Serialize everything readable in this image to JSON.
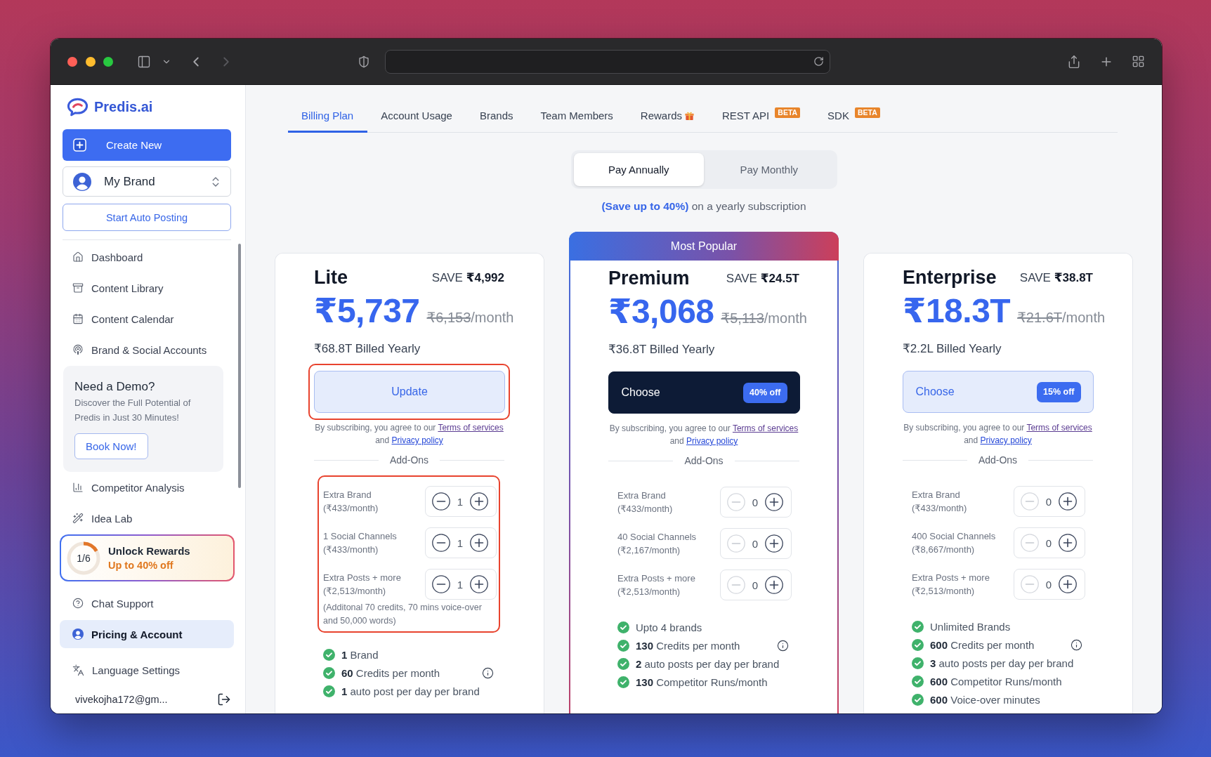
{
  "browser": {
    "back_disabled": false,
    "forward_disabled": true
  },
  "sidebar": {
    "logo": "Predis.ai",
    "create_button": "Create New",
    "brand_select": "My Brand",
    "auto_post_button": "Start Auto Posting",
    "nav": [
      {
        "label": "Dashboard",
        "selected": false
      },
      {
        "label": "Content Library",
        "selected": false
      },
      {
        "label": "Content Calendar",
        "selected": false
      },
      {
        "label": "Brand & Social Accounts",
        "selected": false
      }
    ],
    "demo_card": {
      "title": "Need a Demo?",
      "text": "Discover the Full Potential of Predis in Just 30 Minutes!",
      "button": "Book Now!"
    },
    "nav_more": [
      {
        "label": "Competitor Analysis",
        "selected": false
      },
      {
        "label": "Idea Lab",
        "selected": false
      }
    ],
    "rewards_card": {
      "progress": "1/6",
      "level": 0.167,
      "title": "Unlock Rewards",
      "subtitle": "Up to 40% off"
    },
    "nav_bottom": [
      {
        "label": "Chat Support",
        "selected": false
      },
      {
        "label": "Pricing & Account",
        "selected": true
      }
    ],
    "language_item": {
      "label": "Language Settings",
      "selected": false
    },
    "email": "vivekojha172@gm..."
  },
  "tabs": [
    {
      "label": "Billing Plan",
      "kind": "text",
      "selected": true
    },
    {
      "label": "Account Usage",
      "kind": "text",
      "selected": false
    },
    {
      "label": "Brands",
      "kind": "text",
      "selected": false
    },
    {
      "label": "Team Members",
      "kind": "text",
      "selected": false
    },
    {
      "label": "Rewards",
      "kind": "gift",
      "selected": false
    },
    {
      "label": "REST API",
      "kind": "badge",
      "badge": "BETA",
      "selected": false
    },
    {
      "label": "SDK",
      "kind": "badge",
      "badge": "BETA",
      "selected": false
    }
  ],
  "billing_toggle": [
    {
      "label": "Pay Annually",
      "selected": true
    },
    {
      "label": "Pay Monthly",
      "selected": false
    }
  ],
  "savings_note": "**(Save up to 40%)** on a yearly subscription",
  "plans": [
    {
      "name": "Lite",
      "popular": false,
      "save": "SAVE **₹4,992**",
      "price": "₹5,737",
      "old_price": "₹6,153",
      "period": "/month",
      "billed": "₹68.8T Billed Yearly",
      "cta": {
        "label": "Update",
        "kind": "soft",
        "highlighted": true
      },
      "terms": {
        "before": "By subscribing, you agree to our",
        "joiner": "and",
        "links": [
          {
            "label": "Terms of services",
            "visited": true
          },
          {
            "label": "Privacy policy",
            "visited": false
          }
        ]
      },
      "addons_title": "Add-Ons",
      "addons_highlighted": true,
      "addons": [
        {
          "name": "Extra Brand",
          "price": "(₹433/month)",
          "value": "1",
          "decrease_disabled": false
        },
        {
          "name": "1 Social Channels",
          "price": "(₹433/month)",
          "value": "1",
          "decrease_disabled": false
        },
        {
          "name": "Extra Posts + more",
          "price": "(₹2,513/month)",
          "value": "1",
          "decrease_disabled": false
        }
      ],
      "addons_note": "(Additonal 70 credits, 70 mins voice-over and 50,000 words)",
      "features": [
        {
          "text": "**1** Brand",
          "info": false
        },
        {
          "text": "**60** Credits per month",
          "info": true
        },
        {
          "text": "**1** auto post per day per brand",
          "info": false
        }
      ]
    },
    {
      "name": "Premium",
      "popular": true,
      "ribbon": "Most Popular",
      "save": "SAVE **₹24.5T**",
      "price": "₹3,068",
      "old_price": "₹5,113",
      "period": "/month",
      "billed": "₹36.8T Billed Yearly",
      "cta": {
        "label": "Choose",
        "kind": "dark",
        "badge": "40% off",
        "highlighted": false
      },
      "terms": {
        "before": "By subscribing, you agree to our",
        "joiner": "and",
        "links": [
          {
            "label": "Terms of services",
            "visited": true
          },
          {
            "label": "Privacy policy",
            "visited": false
          }
        ]
      },
      "addons_title": "Add-Ons",
      "addons_highlighted": false,
      "addons": [
        {
          "name": "Extra Brand",
          "price": "(₹433/month)",
          "value": "0",
          "decrease_disabled": true
        },
        {
          "name": "40 Social Channels",
          "price": "(₹2,167/month)",
          "value": "0",
          "decrease_disabled": true
        },
        {
          "name": "Extra Posts + more",
          "price": "(₹2,513/month)",
          "value": "0",
          "decrease_disabled": true
        }
      ],
      "features": [
        {
          "text": "Upto 4 brands",
          "info": false
        },
        {
          "text": "**130** Credits per month",
          "info": true
        },
        {
          "text": "**2** auto posts per day per brand",
          "info": false
        },
        {
          "text": "**130** Competitor Runs/month",
          "info": false
        }
      ]
    },
    {
      "name": "Enterprise",
      "popular": false,
      "save": "SAVE **₹38.8T**",
      "price": "₹18.3T",
      "old_price": "₹21.6T",
      "period": "/month",
      "billed": "₹2.2L Billed Yearly",
      "cta": {
        "label": "Choose",
        "kind": "soft",
        "badge": "15% off",
        "highlighted": false
      },
      "terms": {
        "before": "By subscribing, you agree to our",
        "joiner": "and",
        "links": [
          {
            "label": "Terms of services",
            "visited": true
          },
          {
            "label": "Privacy policy",
            "visited": false
          }
        ]
      },
      "addons_title": "Add-Ons",
      "addons_highlighted": false,
      "addons": [
        {
          "name": "Extra Brand",
          "price": "(₹433/month)",
          "value": "0",
          "decrease_disabled": true
        },
        {
          "name": "400 Social Channels",
          "price": "(₹8,667/month)",
          "value": "0",
          "decrease_disabled": true
        },
        {
          "name": "Extra Posts + more",
          "price": "(₹2,513/month)",
          "value": "0",
          "decrease_disabled": true
        }
      ],
      "features": [
        {
          "text": "Unlimited Brands",
          "info": false
        },
        {
          "text": "**600** Credits per month",
          "info": true
        },
        {
          "text": "**3** auto posts per day per brand",
          "info": false
        },
        {
          "text": "**600** Competitor Runs/month",
          "info": false
        },
        {
          "text": "**600** Voice-over minutes",
          "info": false
        }
      ]
    }
  ]
}
